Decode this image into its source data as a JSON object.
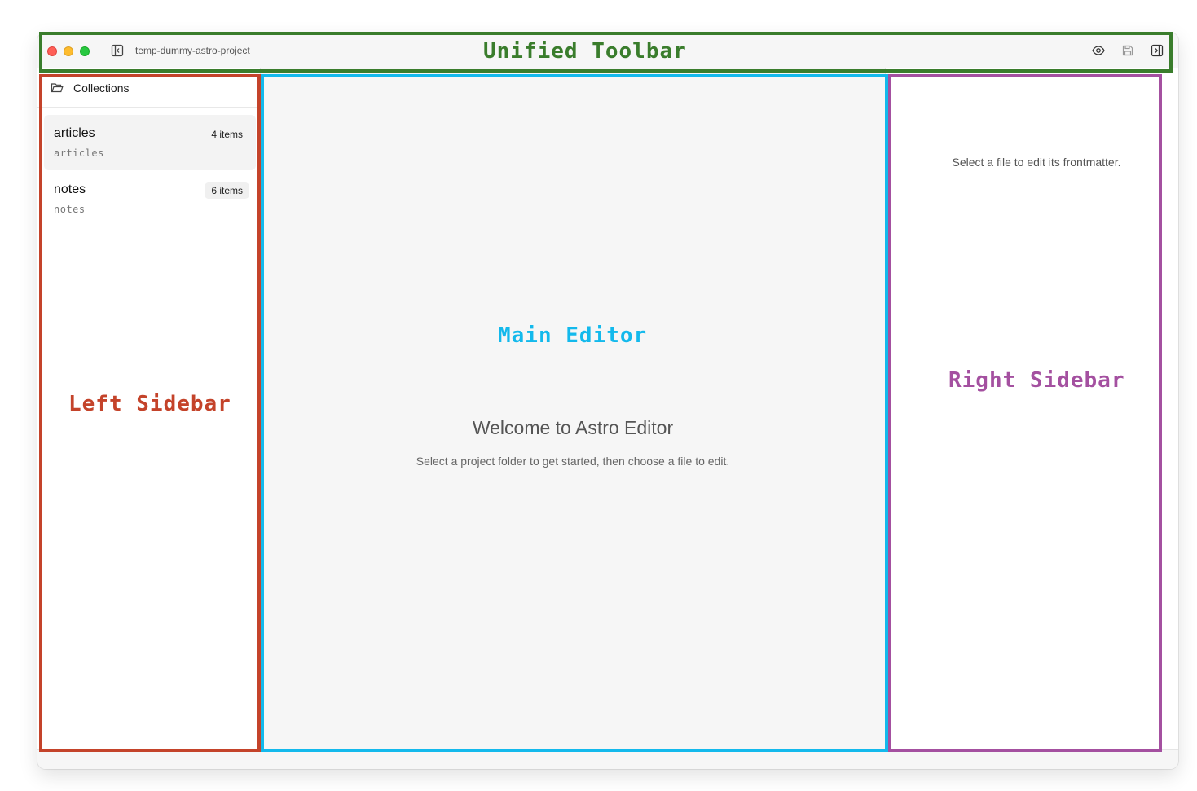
{
  "toolbar": {
    "project_name": "temp-dummy-astro-project",
    "icons": [
      "sidebar-left-toggle-icon",
      "eye-icon",
      "save-icon",
      "sidebar-right-toggle-icon"
    ]
  },
  "left_sidebar": {
    "header_title": "Collections",
    "collections": [
      {
        "name": "articles",
        "path": "articles",
        "count": "4 items",
        "active": true
      },
      {
        "name": "notes",
        "path": "notes",
        "count": "6 items",
        "active": false
      }
    ]
  },
  "editor": {
    "welcome_title": "Welcome to Astro Editor",
    "welcome_subtitle": "Select a project folder to get started, then choose a file to edit."
  },
  "right_sidebar": {
    "hint": "Select a file to edit its frontmatter."
  },
  "annotations": {
    "toolbar": {
      "label": "Unified Toolbar",
      "color": "#3a7d2c"
    },
    "left": {
      "label": "Left Sidebar",
      "color": "#c4432a"
    },
    "main": {
      "label": "Main Editor",
      "color": "#13b9ec"
    },
    "right": {
      "label": "Right Sidebar",
      "color": "#a450a0"
    }
  }
}
